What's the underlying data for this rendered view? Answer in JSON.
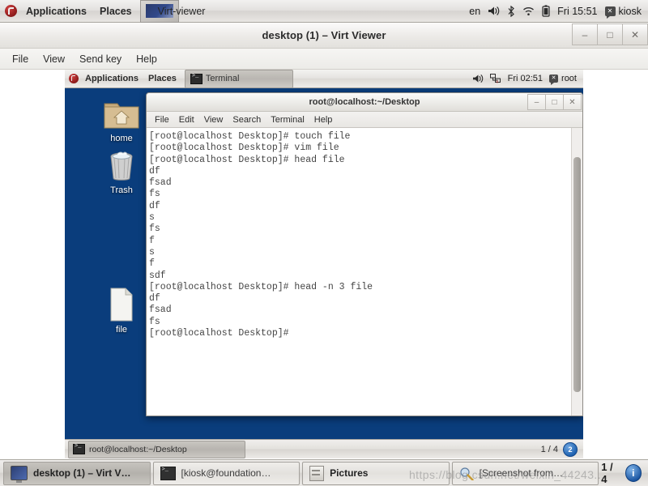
{
  "host_panel": {
    "logo_icon": "fedora-logo-icon",
    "menus": [
      "Applications",
      "Places"
    ],
    "window_task": {
      "icon": "window-thumbnail-icon",
      "label": "Virt-viewer"
    },
    "keyboard_layout": "en",
    "tray_icons": [
      "volume-icon",
      "bluetooth-icon",
      "wifi-icon",
      "battery-icon"
    ],
    "clock": "Fri 15:51",
    "user_icon": "user-icon",
    "user": "kiosk"
  },
  "virt_viewer": {
    "title": "desktop (1) – Virt Viewer",
    "window_buttons": {
      "minimize": "–",
      "maximize": "□",
      "close": "✕"
    },
    "menus": [
      "File",
      "View",
      "Send key",
      "Help"
    ]
  },
  "vm": {
    "panel": {
      "logo_icon": "fedora-logo-icon",
      "menus": [
        "Applications",
        "Places"
      ],
      "window_button": {
        "icon": "terminal-icon",
        "label": "Terminal"
      },
      "tray_icons": [
        "volume-icon",
        "network-disconnected-icon"
      ],
      "clock": "Fri 02:51",
      "user_icon": "user-icon",
      "user": "root"
    },
    "desktop_icons": [
      {
        "icon": "home-folder-icon",
        "label": "home"
      },
      {
        "icon": "trash-icon",
        "label": "Trash"
      },
      {
        "icon": "file-document-icon",
        "label": "file"
      }
    ],
    "taskbar": {
      "window_button": {
        "icon": "terminal-icon",
        "label": "root@localhost:~/Desktop"
      },
      "workspace_indicator": "1 / 4",
      "workspace_badge": "2"
    }
  },
  "terminal": {
    "title": "root@localhost:~/Desktop",
    "window_buttons": {
      "minimize": "–",
      "maximize": "□",
      "close": "✕"
    },
    "menus": [
      "File",
      "Edit",
      "View",
      "Search",
      "Terminal",
      "Help"
    ],
    "content": "[root@localhost Desktop]# touch file\n[root@localhost Desktop]# vim file\n[root@localhost Desktop]# head file\ndf\nfsad\nfs\ndf\ns\nfs\nf\ns\nf\nsdf\n[root@localhost Desktop]# head -n 3 file\ndf\nfsad\nfs\n[root@localhost Desktop]# "
  },
  "host_taskbar": {
    "buttons": [
      {
        "icon": "monitor-icon",
        "label": "desktop (1) – Virt V…",
        "active": true
      },
      {
        "icon": "terminal-icon",
        "label": "[kiosk@foundation…",
        "active": false
      },
      {
        "icon": "file-manager-icon",
        "label": "Pictures",
        "active": false
      },
      {
        "icon": "screenshot-icon",
        "label": "[Screenshot from…",
        "active": false
      }
    ],
    "workspace_indicator": "1 / 4",
    "help_badge": "i"
  },
  "watermark": "https://blog.csdn.net/weixin_44243...",
  "colors": {
    "desktop_blue": "#0a3d7c",
    "panel_gray": "#e3e1dd",
    "terminal_bg": "#ffffff",
    "terminal_fg": "#444444",
    "accent_blue": "#17529f"
  }
}
